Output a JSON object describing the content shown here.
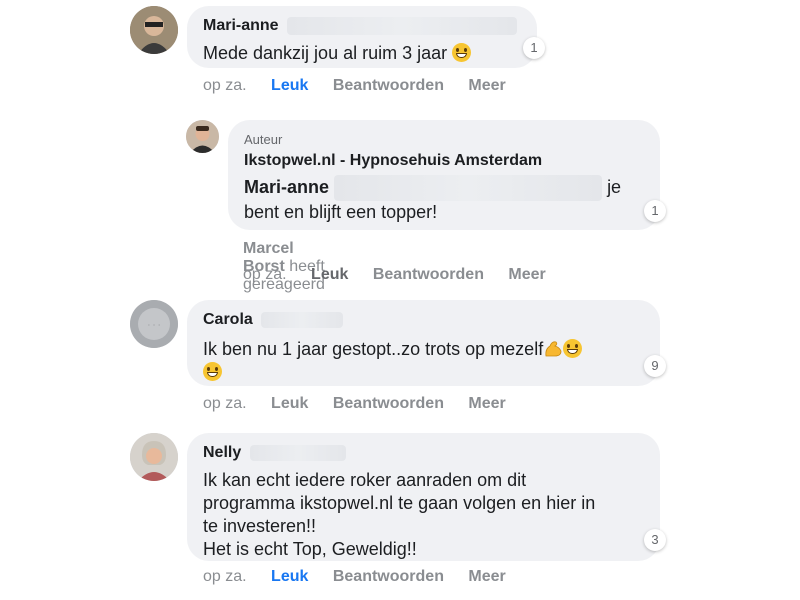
{
  "comments": [
    {
      "name": "Mari-anne",
      "text": "Mede dankzij jou al ruim 3 jaar",
      "reaction_count": "1",
      "actions": {
        "time": "op za.",
        "like": "Leuk",
        "reply": "Beantwoorden",
        "more": "Meer"
      }
    },
    {
      "author_tag": "Auteur",
      "name": "Ikstopwel.nl - Hypnosehuis Amsterdam",
      "mention": "Mari-anne",
      "text_after_mention": "je",
      "text_line2": "bent en blijft een topper!",
      "reaction_count": "1",
      "reacted": {
        "name": "Marcel Borst",
        "suffix": "heeft gereageerd"
      },
      "actions": {
        "time": "op za.",
        "like": "Leuk",
        "reply": "Beantwoorden",
        "more": "Meer"
      }
    },
    {
      "name": "Carola",
      "text": "Ik ben nu 1 jaar gestopt..zo trots op mezelf",
      "reaction_count": "9",
      "actions": {
        "time": "op za.",
        "like": "Leuk",
        "reply": "Beantwoorden",
        "more": "Meer"
      }
    },
    {
      "name": "Nelly",
      "lines": [
        "Ik kan echt iedere roker aanraden om dit",
        "programma ikstopwel.nl te gaan volgen en hier in",
        "te investeren!!",
        "Het is echt Top, Geweldig!!"
      ],
      "reaction_count": "3",
      "actions": {
        "time": "op za.",
        "like": "Leuk",
        "reply": "Beantwoorden",
        "more": "Meer"
      }
    }
  ],
  "colors": {
    "bubble": "#f0f1f4",
    "like_active": "#1877f2",
    "muted": "#8a8d91"
  }
}
